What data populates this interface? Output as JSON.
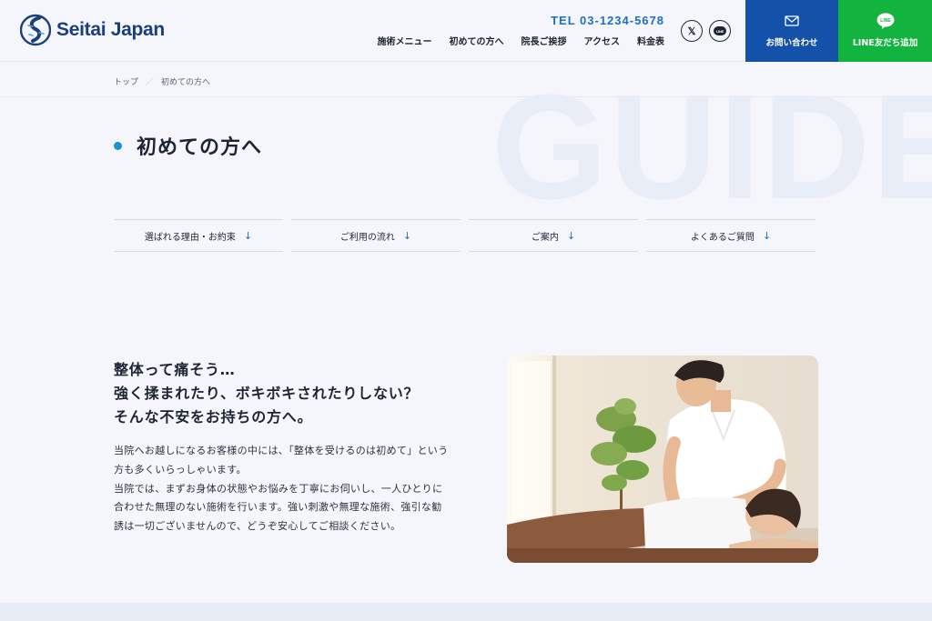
{
  "brand": {
    "name": "Seitai Japan",
    "color": "#1b3f7a"
  },
  "header": {
    "tel": "TEL  03-1234-5678",
    "nav": [
      "施術メニュー",
      "初めての方へ",
      "院長ご挨拶",
      "アクセス",
      "料金表"
    ],
    "sns": [
      {
        "icon": "x-icon",
        "label": "𝕏"
      },
      {
        "icon": "line-icon",
        "label": "LINE"
      }
    ],
    "cta_contact": {
      "label": "お問い合わせ",
      "icon": "mail-icon",
      "color": "#1451a8"
    },
    "cta_line": {
      "label": "LINE友だち追加",
      "icon": "line-bubble-icon",
      "icon_text": "LINE",
      "color": "#12b33f"
    }
  },
  "breadcrumb": {
    "items": [
      "トップ",
      "初めての方へ"
    ],
    "separator": "／"
  },
  "hero": {
    "ghost_text": "GUIDE",
    "title": "初めての方へ"
  },
  "tabs": [
    {
      "label": "選ばれる理由・お約束",
      "arrow": "↓"
    },
    {
      "label": "ご利用の流れ",
      "arrow": "↓"
    },
    {
      "label": "ご案内",
      "arrow": "↓"
    },
    {
      "label": "よくあるご質問",
      "arrow": "↓"
    }
  ],
  "intro": {
    "lead_lines": [
      "整体って痛そう…",
      "強く揉まれたり、ボキボキされたりしない？",
      "そんな不安をお持ちの方へ。"
    ],
    "body_lines": [
      "当院へお越しになるお客様の中には、「整体を受けるのは初めて」という",
      "方も多くいらっしゃいます。",
      "当院では、まずお身体の状態やお悩みを丁寧にお伺いし、一人ひとりに",
      "合わせた無理のない施術を行います。強い刺激や無理な施術、強引な勧",
      "誘は一切ございませんので、どうぞ安心してご相談ください。"
    ]
  },
  "accent_color": "#1e8fd8"
}
